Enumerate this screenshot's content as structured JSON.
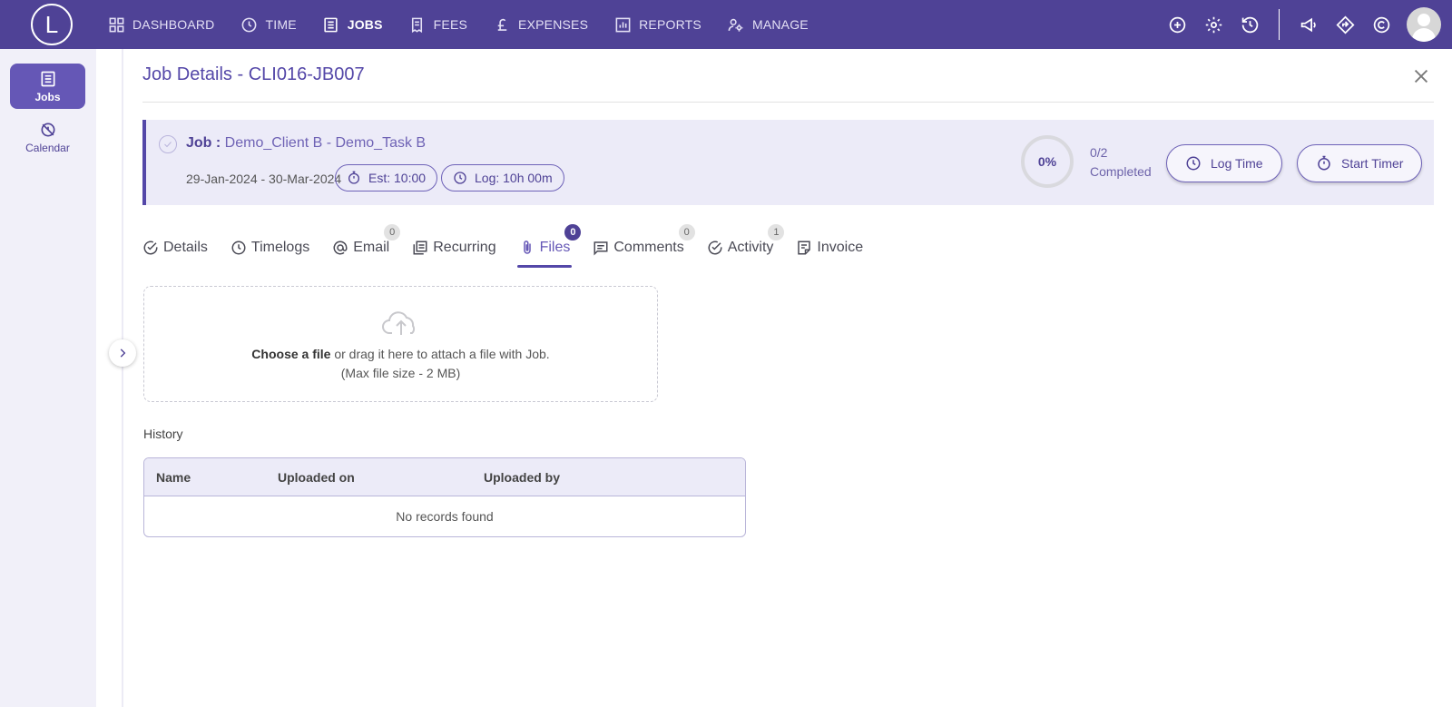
{
  "app": {
    "logo_letter": "L"
  },
  "nav": {
    "items": [
      {
        "label": "DASHBOARD",
        "icon": "dashboard-icon"
      },
      {
        "label": "TIME",
        "icon": "clock-icon"
      },
      {
        "label": "JOBS",
        "icon": "jobs-icon",
        "active": true
      },
      {
        "label": "FEES",
        "icon": "fees-icon"
      },
      {
        "label": "EXPENSES",
        "icon": "pound-icon"
      },
      {
        "label": "REPORTS",
        "icon": "reports-icon"
      },
      {
        "label": "MANAGE",
        "icon": "manage-icon"
      }
    ]
  },
  "sidebar": {
    "items": [
      {
        "label": "Jobs",
        "icon": "jobs-list-icon",
        "active": true
      },
      {
        "label": "Calendar",
        "icon": "calendar-off-icon"
      }
    ]
  },
  "page": {
    "title": "Job Details - CLI016-JB007"
  },
  "job": {
    "prefix": "Job :",
    "name": "Demo_Client B - Demo_Task B",
    "dates": "29-Jan-2024 - 30-Mar-2024",
    "est": "Est: 10:00",
    "log": "Log: 10h 00m",
    "progress_text": "0%",
    "progress_value": 0,
    "completed_count": "0/2",
    "completed_label": "Completed",
    "log_time_label": "Log Time",
    "start_timer_label": "Start Timer"
  },
  "tabs": [
    {
      "label": "Details",
      "icon": "check-circle-icon"
    },
    {
      "label": "Timelogs",
      "icon": "clock-icon"
    },
    {
      "label": "Email",
      "icon": "at-icon",
      "badge": "0"
    },
    {
      "label": "Recurring",
      "icon": "recurring-icon"
    },
    {
      "label": "Files",
      "icon": "paperclip-icon",
      "badge": "0",
      "active": true
    },
    {
      "label": "Comments",
      "icon": "comment-icon",
      "badge": "0"
    },
    {
      "label": "Activity",
      "icon": "activity-check-icon",
      "badge": "1"
    },
    {
      "label": "Invoice",
      "icon": "invoice-icon"
    }
  ],
  "upload": {
    "choose": "Choose a file",
    "rest": " or drag it here to attach a file with Job.",
    "note": "(Max file size - 2 MB)"
  },
  "history": {
    "label": "History",
    "columns": [
      "Name",
      "Uploaded on",
      "Uploaded by"
    ],
    "empty": "No records found"
  },
  "colors": {
    "primary": "#4f4296",
    "card_bg": "#ecebf8"
  }
}
